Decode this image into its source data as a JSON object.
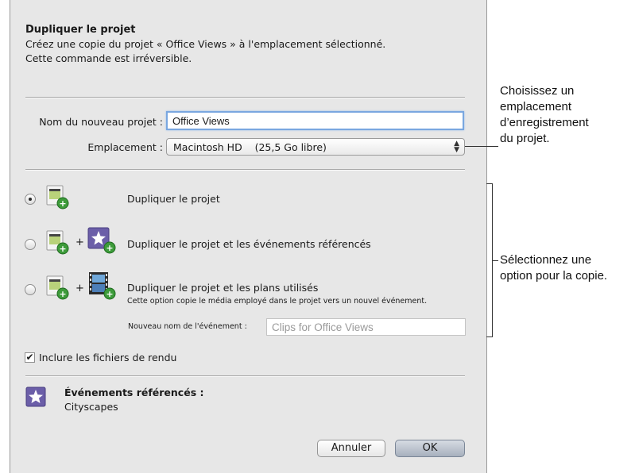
{
  "dialog": {
    "title": "Dupliquer le projet",
    "description_line1": "Créez une copie du projet « Office Views » à l'emplacement sélectionné.",
    "description_line2": "Cette commande est irréversible.",
    "name_label": "Nom du nouveau projet :",
    "name_value": "Office Views",
    "location_label": "Emplacement :",
    "location_value": "Macintosh HD    (25,5 Go libre)",
    "options": [
      {
        "label": "Dupliquer le projet",
        "selected": true
      },
      {
        "label": "Dupliquer le projet et les événements référencés",
        "selected": false
      },
      {
        "label": "Dupliquer le projet et les plans utilisés",
        "selected": false,
        "note": "Cette option copie le média employé dans le projet vers un nouvel événement."
      }
    ],
    "plus_sign": "+",
    "event_name_label": "Nouveau nom de l'événement :",
    "event_name_placeholder": "Clips for Office Views",
    "include_render_label": "Inclure les fichiers de rendu",
    "include_render_checked": true,
    "check_glyph": "✔",
    "referenced_events_title": "Événements référencés :",
    "referenced_events_value": "Cityscapes",
    "cancel_label": "Annuler",
    "ok_label": "OK"
  },
  "callouts": {
    "location": [
      "Choisissez un",
      "emplacement",
      "d’enregistrement",
      "du projet."
    ],
    "option": [
      "Sélectionnez une",
      "option pour la copie."
    ]
  },
  "colors": {
    "dialog_bg": "#e7e7e7",
    "focus_ring": "#7aa7e0",
    "ok_button": "#a7b0bd",
    "event_star": "#6b5ea8"
  }
}
